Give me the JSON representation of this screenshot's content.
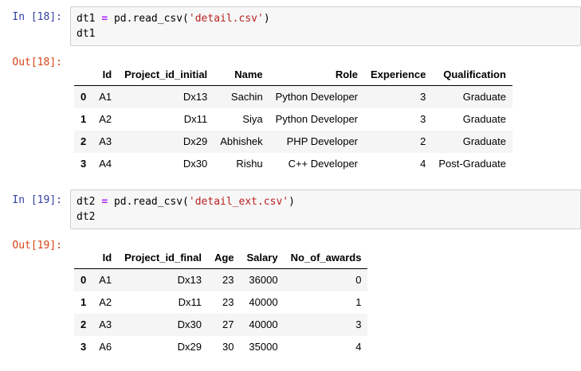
{
  "colors": {
    "input-prompt": "#303F9F",
    "output-prompt": "#D84315",
    "code-string": "#BA2121",
    "code-operator": "#AA22FF",
    "input-bg": "#F7F7F7",
    "input-border": "#CFCFCF",
    "row-stripe": "#F5F5F5",
    "header-border": "#000000"
  },
  "notebook": {
    "cells": [
      {
        "input_prompt": "In [18]:",
        "output_prompt": "Out[18]:",
        "code": {
          "tokens": [
            {
              "text": "dt1 ",
              "type": "plain"
            },
            {
              "text": "=",
              "type": "operator"
            },
            {
              "text": " pd.read_csv(",
              "type": "plain"
            },
            {
              "text": "'detail.csv'",
              "type": "string"
            },
            {
              "text": ")",
              "type": "plain"
            }
          ],
          "line2": "dt1"
        },
        "table": {
          "columns": [
            "Id",
            "Project_id_initial",
            "Name",
            "Role",
            "Experience",
            "Qualification"
          ],
          "index": [
            "0",
            "1",
            "2",
            "3"
          ],
          "rows": [
            [
              "A1",
              "Dx13",
              "Sachin",
              "Python Developer",
              "3",
              "Graduate"
            ],
            [
              "A2",
              "Dx11",
              "Siya",
              "Python Developer",
              "3",
              "Graduate"
            ],
            [
              "A3",
              "Dx29",
              "Abhishek",
              "PHP Developer",
              "2",
              "Graduate"
            ],
            [
              "A4",
              "Dx30",
              "Rishu",
              "C++ Developer",
              "4",
              "Post-Graduate"
            ]
          ]
        }
      },
      {
        "input_prompt": "In [19]:",
        "output_prompt": "Out[19]:",
        "code": {
          "tokens": [
            {
              "text": "dt2 ",
              "type": "plain"
            },
            {
              "text": "=",
              "type": "operator"
            },
            {
              "text": " pd.read_csv(",
              "type": "plain"
            },
            {
              "text": "'detail_ext.csv'",
              "type": "string"
            },
            {
              "text": ")",
              "type": "plain"
            }
          ],
          "line2": "dt2"
        },
        "table": {
          "columns": [
            "Id",
            "Project_id_final",
            "Age",
            "Salary",
            "No_of_awards"
          ],
          "index": [
            "0",
            "1",
            "2",
            "3"
          ],
          "rows": [
            [
              "A1",
              "Dx13",
              "23",
              "36000",
              "0"
            ],
            [
              "A2",
              "Dx11",
              "23",
              "40000",
              "1"
            ],
            [
              "A3",
              "Dx30",
              "27",
              "40000",
              "3"
            ],
            [
              "A6",
              "Dx29",
              "30",
              "35000",
              "4"
            ]
          ]
        }
      }
    ]
  }
}
